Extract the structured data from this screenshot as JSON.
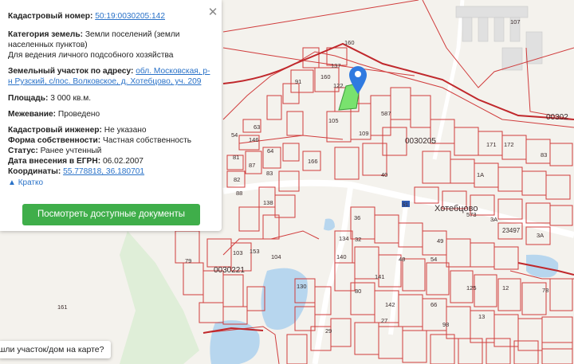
{
  "panel": {
    "cadastral_number_label": "Кадастровый номер:",
    "cadastral_number_value": "50:19:0030205:142",
    "land_category_label": "Категория земель:",
    "land_category_value": "Земли поселений (земли населенных пунктов)",
    "land_use_value": "Для ведения личного подсобного хозяйства",
    "address_label": "Земельный участок по адресу:",
    "address_value": "обл. Московская, р-н Рузский, с/пос. Волковское, д. Хотебцово, уч. 209",
    "area_label": "Площадь:",
    "area_value": "3 000 кв.м.",
    "survey_label": "Межевание:",
    "survey_value": "Проведено",
    "engineer_label": "Кадастровый инженер:",
    "engineer_value": "Не указано",
    "ownership_label": "Форма собственности:",
    "ownership_value": "Частная собственность",
    "status_label": "Статус:",
    "status_value": "Ранее учтенный",
    "egrn_date_label": "Дата внесения в ЕГРН:",
    "egrn_date_value": "06.02.2007",
    "coords_label": "Координаты:",
    "coords_value": "55.778818, 36.180701",
    "brief_link": "Кратко",
    "docs_button": "Посмотреть доступные документы",
    "close_icon": "close-icon"
  },
  "bubble": {
    "text": "шли участок/дом на карте?"
  },
  "map": {
    "village_name": "Хотебцово",
    "road_label": "23497",
    "bus_stop_label": "51",
    "quarter_labels": [
      "0030205",
      "0030221",
      "00302"
    ],
    "parcel_labels": [
      "160",
      "107",
      "161",
      "91",
      "137",
      "160",
      "122",
      "105",
      "109",
      "587",
      "146",
      "54",
      "63",
      "64",
      "81",
      "82",
      "87",
      "83",
      "88",
      "138",
      "166",
      "40",
      "36",
      "32",
      "134",
      "140",
      "153",
      "79",
      "103",
      "104",
      "130",
      "29",
      "27",
      "48",
      "49",
      "54",
      "80",
      "142",
      "66",
      "13",
      "98",
      "171",
      "172",
      "83",
      "573",
      "3А",
      "3А",
      "1А",
      "78",
      "125",
      "12",
      "141"
    ],
    "colors": {
      "parcel": "#d03c3c",
      "selected": "#79e26e",
      "water": "#b7d6ee",
      "pin": "#2f7ae0",
      "road": "#ffffff"
    }
  }
}
